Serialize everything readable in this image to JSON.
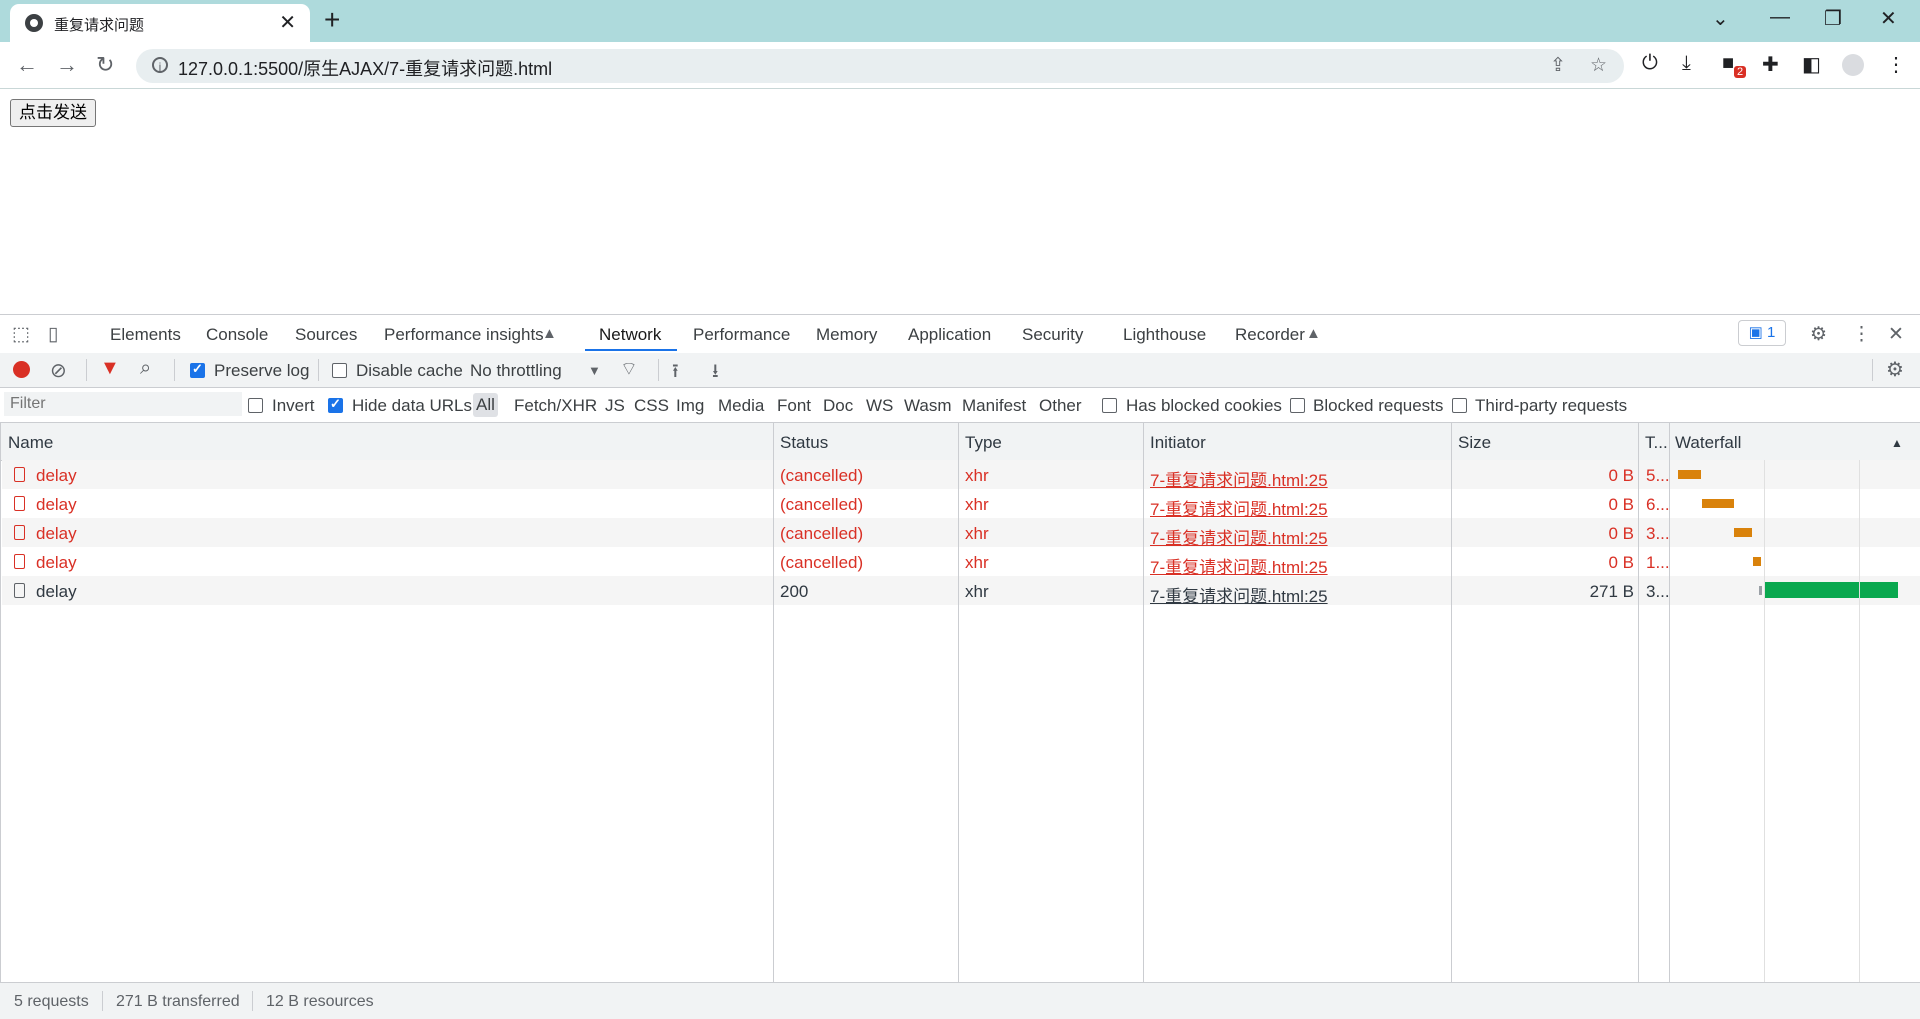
{
  "browser": {
    "tab_title": "重复请求问题",
    "url": "127.0.0.1:5500/原生AJAX/7-重复请求问题.html",
    "extension_badge": "2"
  },
  "page": {
    "send_button": "点击发送"
  },
  "devtools": {
    "tabs": [
      "Elements",
      "Console",
      "Sources",
      "Performance insights",
      "Network",
      "Performance",
      "Memory",
      "Application",
      "Security",
      "Lighthouse",
      "Recorder"
    ],
    "active_tab": "Network",
    "issues_count": "1",
    "toolbar": {
      "preserve_log": "Preserve log",
      "disable_cache": "Disable cache",
      "throttling": "No throttling"
    },
    "filter": {
      "placeholder": "Filter",
      "invert": "Invert",
      "hide_data_urls": "Hide data URLs",
      "types": [
        "All",
        "Fetch/XHR",
        "JS",
        "CSS",
        "Img",
        "Media",
        "Font",
        "Doc",
        "WS",
        "Wasm",
        "Manifest",
        "Other"
      ],
      "has_blocked_cookies": "Has blocked cookies",
      "blocked_requests": "Blocked requests",
      "third_party": "Third-party requests"
    },
    "columns": {
      "name": "Name",
      "status": "Status",
      "type": "Type",
      "initiator": "Initiator",
      "size": "Size",
      "time": "T...",
      "waterfall": "Waterfall"
    },
    "requests": [
      {
        "name": "delay",
        "status": "(cancelled)",
        "type": "xhr",
        "initiator": "7-重复请求问题.html:25",
        "size": "0 B",
        "time": "5...",
        "error": true
      },
      {
        "name": "delay",
        "status": "(cancelled)",
        "type": "xhr",
        "initiator": "7-重复请求问题.html:25",
        "size": "0 B",
        "time": "6...",
        "error": true
      },
      {
        "name": "delay",
        "status": "(cancelled)",
        "type": "xhr",
        "initiator": "7-重复请求问题.html:25",
        "size": "0 B",
        "time": "3...",
        "error": true
      },
      {
        "name": "delay",
        "status": "(cancelled)",
        "type": "xhr",
        "initiator": "7-重复请求问题.html:25",
        "size": "0 B",
        "time": "1...",
        "error": true
      },
      {
        "name": "delay",
        "status": "200",
        "type": "xhr",
        "initiator": "7-重复请求问题.html:25",
        "size": "271 B",
        "time": "3...",
        "error": false
      }
    ],
    "summary": {
      "requests": "5 requests",
      "transferred": "271 B transferred",
      "resources": "12 B resources"
    },
    "colors": {
      "error": "#d93025",
      "waiting": "#d9820b",
      "download": "#0aa84f",
      "record": "#d93025",
      "accent": "#1a73e8"
    }
  }
}
